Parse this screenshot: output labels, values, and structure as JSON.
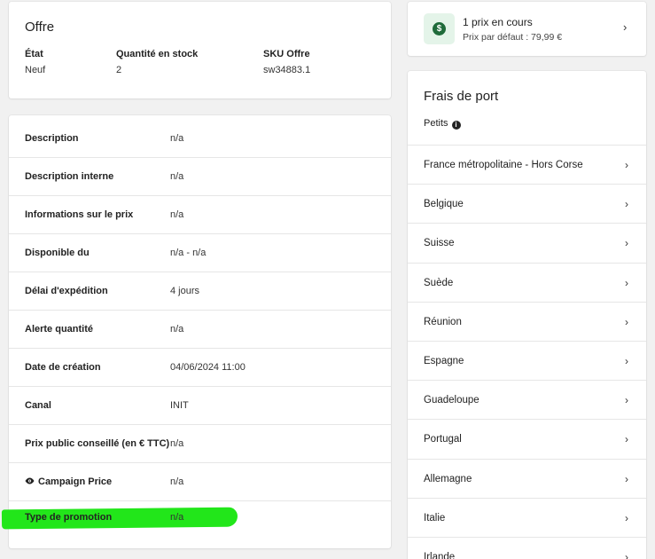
{
  "offre": {
    "title": "Offre",
    "fields": [
      {
        "label": "État",
        "value": "Neuf"
      },
      {
        "label": "Quantité en stock",
        "value": "2"
      },
      {
        "label": "SKU Offre",
        "value": "sw34883.1"
      }
    ]
  },
  "details": {
    "rows": [
      {
        "label": "Description",
        "value": "n/a"
      },
      {
        "label": "Description interne",
        "value": "n/a"
      },
      {
        "label": "Informations sur le prix",
        "value": "n/a"
      },
      {
        "label": "Disponible du",
        "value": "n/a - n/a"
      },
      {
        "label": "Délai d'expédition",
        "value": "4 jours"
      },
      {
        "label": "Alerte quantité",
        "value": "n/a"
      },
      {
        "label": "Date de création",
        "value": "04/06/2024 11:00"
      },
      {
        "label": "Canal",
        "value": "INIT"
      },
      {
        "label": "Prix public conseillé (en € TTC)",
        "value": "n/a"
      },
      {
        "label": "Campaign Price",
        "value": "n/a",
        "icon": "eye-icon"
      },
      {
        "label": "Type de promotion",
        "value": "n/a",
        "highlight_color": "#22e61a"
      }
    ]
  },
  "prix": {
    "icon": "dollar-icon",
    "title": "1 prix en cours",
    "subtitle": "Prix par défaut : 79,99 €",
    "chevron": "›"
  },
  "frais": {
    "title": "Frais de port",
    "subtitle": "Petits",
    "info_icon": "i",
    "chevron": "›",
    "destinations": [
      "France métropolitaine - Hors Corse",
      "Belgique",
      "Suisse",
      "Suède",
      "Réunion",
      "Espagne",
      "Guadeloupe",
      "Portugal",
      "Allemagne",
      "Italie",
      "Irlande"
    ]
  },
  "colors": {
    "background": "#f1f1f1",
    "card": "#ffffff",
    "accent_green": "#1f6b3a",
    "highlight": "#22e61a"
  }
}
